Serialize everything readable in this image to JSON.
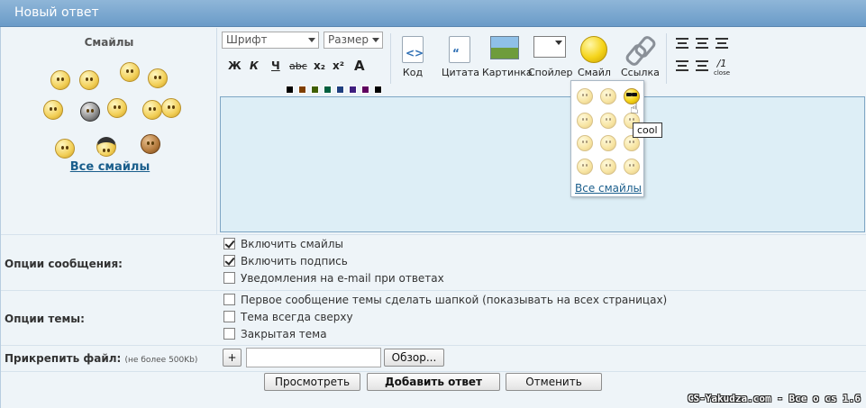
{
  "header": {
    "title": "Новый ответ"
  },
  "smiles_panel": {
    "title": "Смайлы",
    "all_link": "Все смайлы"
  },
  "toolbar": {
    "font_select": "Шрифт",
    "size_select": "Размер",
    "format_buttons": [
      "Ж",
      "К",
      "Ч",
      "abc",
      "x₂",
      "x²",
      "A"
    ],
    "tools": {
      "code": "Код",
      "quote": "Цитата",
      "picture": "Картинка",
      "spoiler": "Спойлер",
      "smile": "Смайл",
      "link": "Ссылка"
    },
    "close_label": "close",
    "palette": [
      "#000000",
      "#7f3f00",
      "#3f5f00",
      "#005f3f",
      "#1f3f7f",
      "#3f1f7f",
      "#5f005f",
      "#000000",
      "#cc0000",
      "#cc7a00",
      "#7a9900",
      "#009966",
      "#3366cc",
      "#6633cc",
      "#993399",
      "#555555",
      "#ff3333",
      "#ffaa00",
      "#99cc33",
      "#33cc99",
      "#3399ff",
      "#9966ff",
      "#cc66cc",
      "#999999",
      "#ff6666",
      "#ffcc33",
      "#ccff66",
      "#66ffcc",
      "#66ccff",
      "#cc99ff",
      "#ff99ff",
      "#dddddd"
    ]
  },
  "smile_popup": {
    "tooltip": "cool",
    "all_link": "Все смайлы"
  },
  "message_options": {
    "label": "Опции сообщения:",
    "items": [
      {
        "label": "Включить смайлы",
        "checked": true
      },
      {
        "label": "Включить подпись",
        "checked": true
      },
      {
        "label": "Уведомления на e-mail при ответах",
        "checked": false
      }
    ]
  },
  "topic_options": {
    "label": "Опции темы:",
    "items": [
      {
        "label": "Первое сообщение темы сделать шапкой (показывать на всех страницах)",
        "checked": false
      },
      {
        "label": "Тема всегда сверху",
        "checked": false
      },
      {
        "label": "Закрытая тема",
        "checked": false
      }
    ]
  },
  "attach": {
    "label": "Прикрепить файл:",
    "hint": "(не более 500Kb)",
    "add": "+",
    "browse": "Обзор..."
  },
  "actions": {
    "preview": "Просмотреть",
    "submit": "Добавить ответ",
    "cancel": "Отменить"
  },
  "watermark": "CS-Yakudza.com - Все о cs 1.6"
}
